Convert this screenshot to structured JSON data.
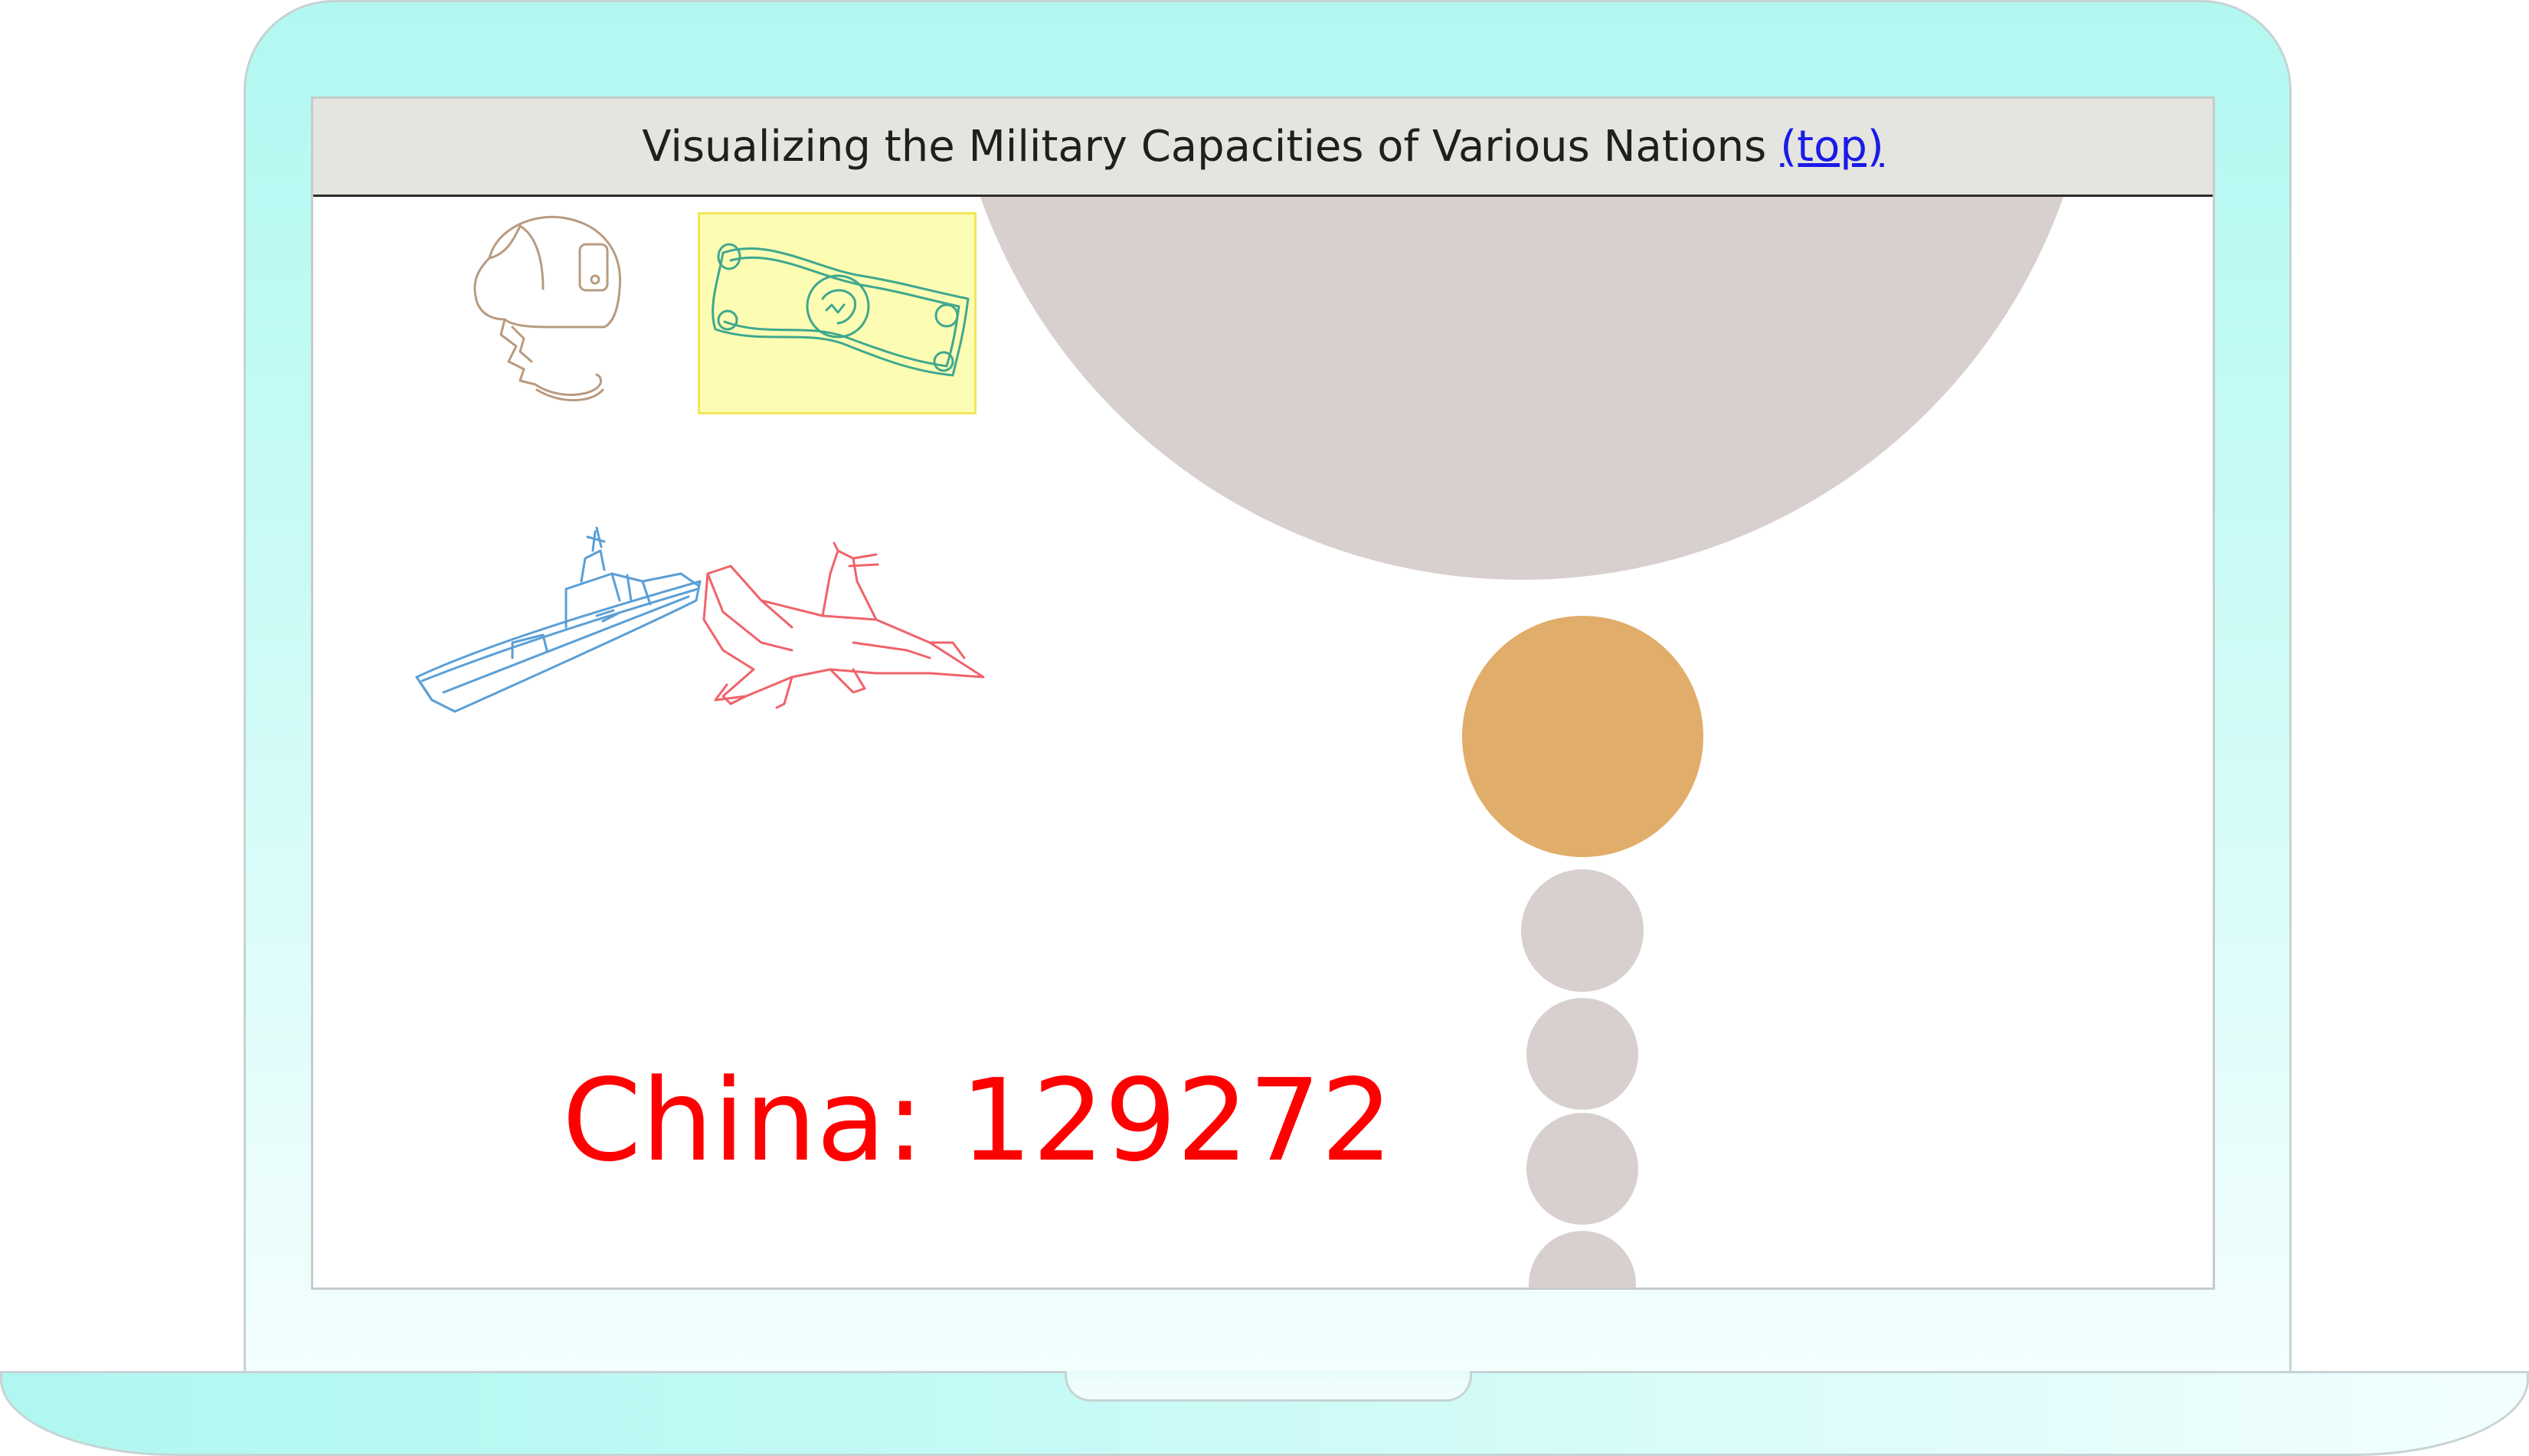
{
  "header": {
    "title": "Visualizing the Military Capacities of Various Nations",
    "top_link": "(top)"
  },
  "icons": [
    {
      "name": "helmet-icon",
      "color": "#b89b80",
      "selected": false
    },
    {
      "name": "money-icon",
      "color": "#3fa88e",
      "selected": true,
      "highlight": "#fdfcb3"
    },
    {
      "name": "warship-icon",
      "color": "#5a9fd6",
      "selected": false
    },
    {
      "name": "fighter-jet-icon",
      "color": "#f0626a",
      "selected": false
    }
  ],
  "readout": {
    "text": "China: 129272"
  },
  "colors": {
    "bubble_default": "#d8cfcf",
    "bubble_highlight": "#e1ad6a",
    "readout": "#ff0000",
    "link": "#1a1ae8"
  }
}
